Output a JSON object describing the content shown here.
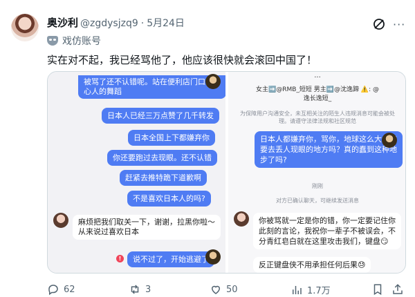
{
  "author": {
    "display_name": "奥沙利",
    "handle": "@zgdysjzq9",
    "dot": "·",
    "date": "5月24日",
    "label": "戏仿账号"
  },
  "tweet_text": "实在对不起，我已经骂他了，他应该很快就会滚回中国了！",
  "media": {
    "left": {
      "bubbles": [
        {
          "text": "被骂了还不认错呢。站在便利店门口跳恶",
          "style": "blue"
        },
        {
          "text": "心人的舞蹈",
          "style": "blue"
        },
        {
          "text": "日本人已经三万点赞了几千转发",
          "style": "blue"
        },
        {
          "text": "日本全国上下都嫌弃你",
          "style": "blue"
        },
        {
          "text": "你还要跑过去现眼。还不认错",
          "style": "blue"
        },
        {
          "text": "赶紧去推特跪下道歉啊",
          "style": "blue"
        },
        {
          "text": "不是喜欢日本人的吗?",
          "style": "blue"
        },
        {
          "text": "麻烦把我们取关一下，谢谢，拉黑你啦～",
          "style": "white"
        },
        {
          "text": "从来说过喜欢日本",
          "style": "white"
        },
        {
          "text": "说不过了，开始逃避了",
          "style": "blue"
        }
      ],
      "error_mark": "!"
    },
    "right": {
      "top_title": "...",
      "info_line1": "女主➡️@RMB_短短  男主➡️@沈逸蹄 ⚠️: @",
      "info_line2": "逸长逸短_",
      "notice_line1": "为保障用户沟通安全，未互相关注的陌生人违规消息可能会被处",
      "notice_line2": "理。请遵守法律法规和社区规范",
      "bubbles": [
        {
          "text": "日本人都嫌弃你，骂你，地球这么大一定",
          "style": "blue"
        },
        {
          "text": "要去丢人现眼的地方吗？真的蠢到这种地",
          "style": "blue"
        },
        {
          "text": "步了吗?",
          "style": "blue"
        },
        {
          "text": "你被骂就一定是你的错，你一定要记住你",
          "style": "white"
        },
        {
          "text": "此刻的言论，我祝你一辈子不被误会，不",
          "style": "white"
        },
        {
          "text": "分青红皂白就在这里攻击我们，键盘😏",
          "style": "white"
        },
        {
          "text": "反正键盘侠不用承担任何后果😓",
          "style": "white"
        }
      ],
      "sys1": "刚刚",
      "sys2": "对方已确认聊天，可继续发送消息"
    }
  },
  "actions": {
    "replies": "62",
    "reposts": "3",
    "likes": "50",
    "views": "1.7万"
  },
  "colors": {
    "bubble_blue": "#4f7cf3",
    "text_secondary": "#536471"
  },
  "icons": [
    "grok-icon",
    "more-icon",
    "mask-icon",
    "reply-icon",
    "repost-icon",
    "like-icon",
    "views-icon",
    "bookmark-icon",
    "share-icon"
  ]
}
